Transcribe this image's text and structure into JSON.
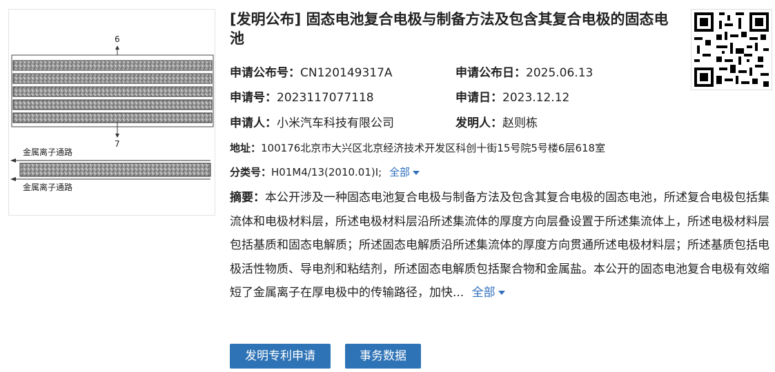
{
  "figure": {
    "label_top": "6",
    "label_bottom": "7",
    "path_label_top": "金属离子通路",
    "path_label_bottom": "金属离子通路"
  },
  "title": "[发明公布] 固态电池复合电极与制备方法及包含其复合电极的固态电池",
  "fields": {
    "pub_no_label": "申请公布号：",
    "pub_no": "CN120149317A",
    "pub_date_label": "申请公布日：",
    "pub_date": "2025.06.13",
    "app_no_label": "申请号：",
    "app_no": "2023117077118",
    "app_date_label": "申请日：",
    "app_date": "2023.12.12",
    "applicant_label": "申请人：",
    "applicant": "小米汽车科技有限公司",
    "inventor_label": "发明人：",
    "inventor": "赵则栋",
    "address_label": "地址：",
    "address": "100176北京市大兴区北京经济技术开发区科创十街15号院5号楼6层618室",
    "class_label": "分类号：",
    "class": "H01M4/13(2010.01)I;",
    "class_more": "全部"
  },
  "abstract": {
    "label": "摘要：",
    "text": "本公开涉及一种固态电池复合电极与制备方法及包含其复合电极的固态电池，所述复合电极包括集流体和电极材料层，所述电极材料层沿所述集流体的厚度方向层叠设置于所述集流体上，所述电极材料层包括基质和固态电解质；所述固态电解质沿所述集流体的厚度方向贯通所述电极材料层；所述基质包括电极活性物质、导电剂和粘结剂，所述固态电解质包括聚合物和金属盐。本公开的固态电池复合电极有效缩短了金属离子在厚电极中的传输路径，加快...",
    "more": "全部"
  },
  "buttons": {
    "invention_app": "发明专利申请",
    "transaction_data": "事务数据"
  },
  "colors": {
    "link": "#2f6fbd",
    "button": "#2e73b6"
  }
}
